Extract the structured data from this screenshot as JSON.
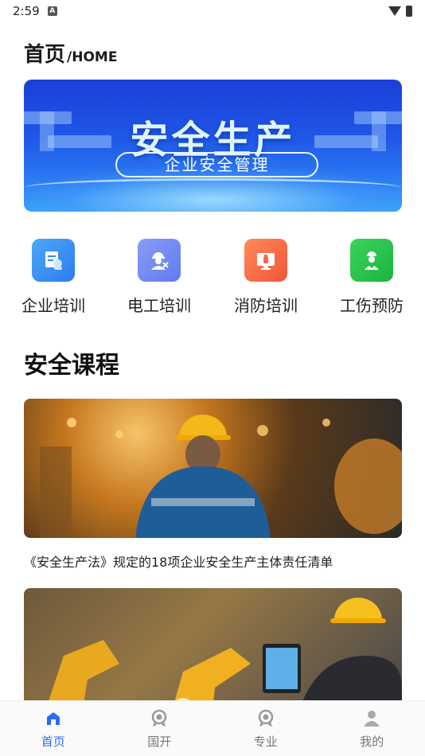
{
  "status": {
    "time": "2:59",
    "badge": "A"
  },
  "header": {
    "title": "首页",
    "subtitle": "/HOME"
  },
  "banner": {
    "title": "安全生产",
    "subtitle": "企业安全管理"
  },
  "quick_entries": [
    {
      "label": "企业培训",
      "icon": "training-doc-icon",
      "color": "#3b8ff5"
    },
    {
      "label": "电工培训",
      "icon": "electrician-icon",
      "color": "#6f8cf5"
    },
    {
      "label": "消防培训",
      "icon": "fire-extinguisher-icon",
      "color": "#f5694a"
    },
    {
      "label": "工伤预防",
      "icon": "worker-safety-icon",
      "color": "#28c24a"
    }
  ],
  "section": {
    "title": "安全课程"
  },
  "courses": [
    {
      "title": "《安全生产法》规定的18项企业安全生产主体责任清单"
    },
    {
      "title": ""
    }
  ],
  "tabs": [
    {
      "label": "首页",
      "icon": "home-icon",
      "active": true
    },
    {
      "label": "国开",
      "icon": "medal-icon",
      "active": false
    },
    {
      "label": "专业",
      "icon": "medal-icon",
      "active": false
    },
    {
      "label": "我的",
      "icon": "user-icon",
      "active": false
    }
  ],
  "colors": {
    "accent": "#2a6df4"
  }
}
